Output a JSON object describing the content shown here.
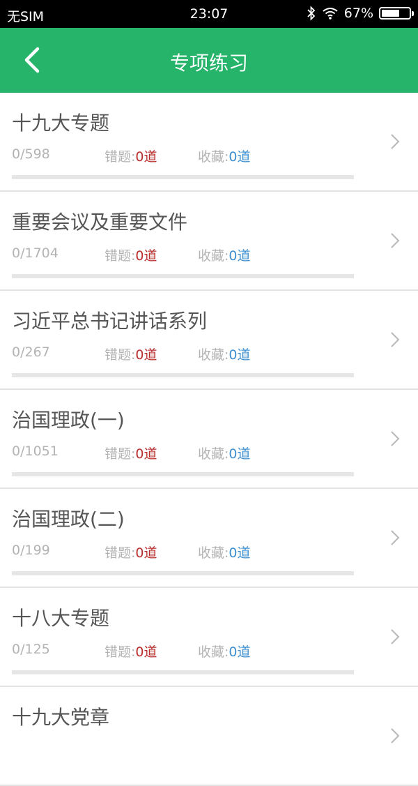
{
  "status_bar": {
    "carrier": "无SIM",
    "time": "23:07",
    "battery_text": "67%",
    "battery_level": 0.67
  },
  "header": {
    "title": "专项练习",
    "back_icon": "chevron-left-icon"
  },
  "colors": {
    "header_bg": "#25b46a",
    "wrong_value": "#b92d2d",
    "favorite_value": "#3d8fd1"
  },
  "items": [
    {
      "title": "十九大专题",
      "progress": "0/598",
      "progress_fraction": 0,
      "wrong_label": "错题:",
      "wrong_value": "0道",
      "fav_label": "收藏:",
      "fav_value": "0道"
    },
    {
      "title": "重要会议及重要文件",
      "progress": "0/1704",
      "progress_fraction": 0,
      "wrong_label": "错题:",
      "wrong_value": "0道",
      "fav_label": "收藏:",
      "fav_value": "0道"
    },
    {
      "title": "习近平总书记讲话系列",
      "progress": "0/267",
      "progress_fraction": 0,
      "wrong_label": "错题:",
      "wrong_value": "0道",
      "fav_label": "收藏:",
      "fav_value": "0道"
    },
    {
      "title": "治国理政(一)",
      "progress": "0/1051",
      "progress_fraction": 0,
      "wrong_label": "错题:",
      "wrong_value": "0道",
      "fav_label": "收藏:",
      "fav_value": "0道"
    },
    {
      "title": "治国理政(二)",
      "progress": "0/199",
      "progress_fraction": 0,
      "wrong_label": "错题:",
      "wrong_value": "0道",
      "fav_label": "收藏:",
      "fav_value": "0道"
    },
    {
      "title": "十八大专题",
      "progress": "0/125",
      "progress_fraction": 0,
      "wrong_label": "错题:",
      "wrong_value": "0道",
      "fav_label": "收藏:",
      "fav_value": "0道"
    },
    {
      "title": "十九大党章"
    }
  ]
}
